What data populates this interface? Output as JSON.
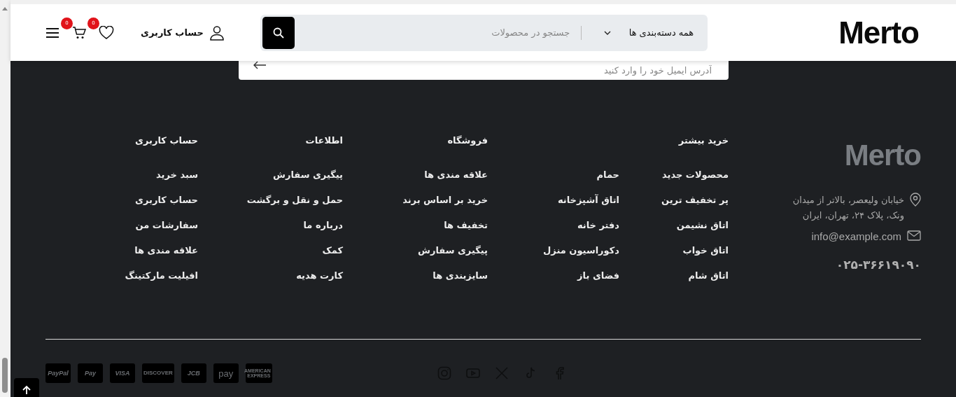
{
  "header": {
    "logo": "Merto",
    "search": {
      "category": "همه دسته‌بندی ها",
      "placeholder": "جستجو در محصولات"
    },
    "account": "حساب کاربری",
    "wishlist_count": "0",
    "cart_count": "0"
  },
  "newsletter": {
    "placeholder": "آدرس ایمیل خود را وارد کنید"
  },
  "footer": {
    "logo": "Merto",
    "address": "خیابان ولیعصر، بالاتر از میدان ونک، پلاک ۲۴، تهران، ایران",
    "email": "info@example.com",
    "phone": "۰۲۵-۳۶۶۱۹۰۹۰",
    "columns": [
      {
        "title": "خرید بیشتر",
        "groups": [
          [
            "محصولات جدید",
            "پر تخفیف ترین",
            "اتاق نشیمن",
            "اتاق خواب",
            "اتاق شام"
          ],
          [
            "حمام",
            "اتاق آشپزخانه",
            "دفتر خانه",
            "دکوراسیون منزل",
            "فضای باز"
          ]
        ]
      },
      {
        "title": "فروشگاه",
        "groups": [
          [
            "علاقه مندی ها",
            "خرید بر اساس برند",
            "تخفیف ها",
            "پیگیری سفارش",
            "سایزبندی ها"
          ]
        ]
      },
      {
        "title": "اطلاعات",
        "groups": [
          [
            "پیگیری سفارش",
            "حمل و نقل و برگشت",
            "درباره ما",
            "کمک",
            "کارت هدیه"
          ]
        ]
      },
      {
        "title": "حساب کاربری",
        "groups": [
          [
            "سبد خرید",
            "حساب کاربری",
            "سفارشات من",
            "علاقه مندی ها",
            "افیلیت مارکتینگ"
          ]
        ]
      }
    ],
    "payment_methods": [
      "AMERICAN EXPRESS",
      "pay",
      "JCB",
      "DISCOVER",
      "VISA",
      "Pay",
      "PayPal"
    ]
  }
}
